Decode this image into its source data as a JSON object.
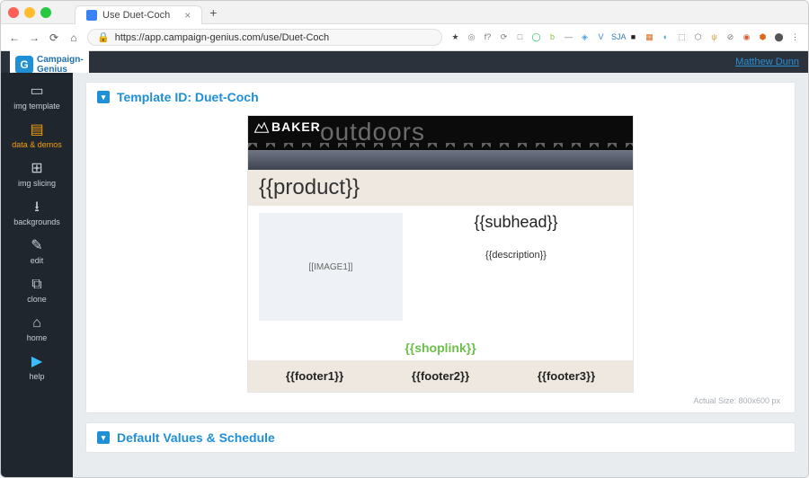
{
  "browser": {
    "tab_title": "Use Duet-Coch",
    "url": "https://app.campaign-genius.com/use/Duet-Coch"
  },
  "app": {
    "brand_line1": "Campaign-",
    "brand_line2": "Genius",
    "user_link": "Matthew Dunn"
  },
  "sidebar": {
    "items": [
      {
        "icon": "▭",
        "label": "img template"
      },
      {
        "icon": "▤",
        "label": "data & demos"
      },
      {
        "icon": "⊞",
        "label": "img slicing"
      },
      {
        "icon": "⭳",
        "label": "backgrounds"
      },
      {
        "icon": "✎",
        "label": "edit"
      },
      {
        "icon": "⧉",
        "label": "clone"
      },
      {
        "icon": "⌂",
        "label": "home"
      },
      {
        "icon": "▶",
        "label": "help"
      }
    ]
  },
  "panel1": {
    "title": "Template ID: Duet-Coch",
    "hero_brand": "BAKER",
    "hero_word": "outdoors",
    "product": "{{product}}",
    "image_ph": "[[IMAGE1]]",
    "subhead": "{{subhead}}",
    "description": "{{description}}",
    "shoplink": "{{shoplink}}",
    "footer1": "{{footer1}}",
    "footer2": "{{footer2}}",
    "footer3": "{{footer3}}",
    "actual_size": "Actual Size: 800x600 px"
  },
  "panel2": {
    "title": "Default Values & Schedule"
  },
  "ext_labels": [
    "★",
    "◎",
    "f?",
    "⟳",
    "□",
    "◯",
    "b",
    "—",
    "◈",
    "V",
    "SJA",
    "■",
    "▦",
    "◐",
    "⬚",
    "⬡",
    "ψ",
    "⊘",
    "◉",
    "⬢",
    "⬤",
    "⋮"
  ],
  "ext_colors": [
    "#444",
    "#777",
    "#777",
    "#777",
    "#777",
    "#1fbf5c",
    "#8bc34a",
    "#777",
    "#4aa3df",
    "#3b82f6",
    "#2f7abf",
    "#222",
    "#e06a1f",
    "#3fa3d8",
    "#777",
    "#777",
    "#d9a24a",
    "#777",
    "#d65a3a",
    "#e0671f",
    "#555",
    "#555"
  ]
}
